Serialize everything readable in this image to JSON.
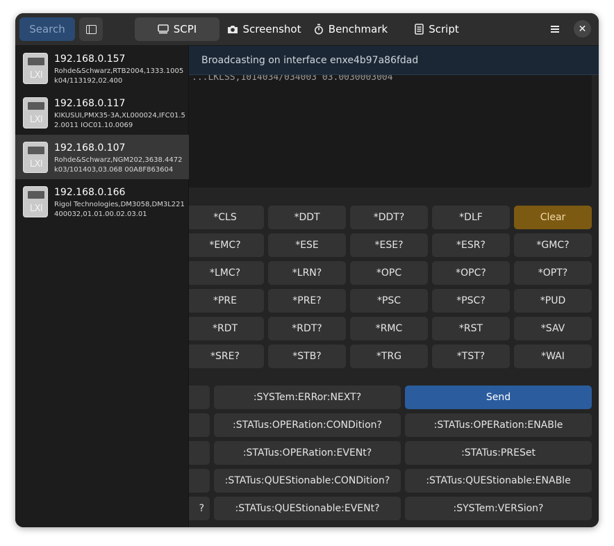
{
  "header": {
    "search_label": "Search",
    "tabs": [
      {
        "label": "SCPI",
        "icon": "monitor-icon",
        "active": true
      },
      {
        "label": "Screenshot",
        "icon": "camera-icon",
        "active": false
      },
      {
        "label": "Benchmark",
        "icon": "stopwatch-icon",
        "active": false
      },
      {
        "label": "Script",
        "icon": "document-icon",
        "active": false
      }
    ]
  },
  "banner": "Broadcasting on interface enxe4b97a86fdad",
  "response_text": "...LKLSS,1014034/034003 03.0030003004",
  "devices": [
    {
      "ip": "192.168.0.157",
      "id": "Rohde&Schwarz,RTB2004,1333.1005k04/113192,02.400",
      "selected": false
    },
    {
      "ip": "192.168.0.117",
      "id": "KIKUSUI,PMX35-3A,XL000024,IFC01.52.0011 IOC01.10.0069",
      "selected": false
    },
    {
      "ip": "192.168.0.107",
      "id": "Rohde&Schwarz,NGM202,3638.4472k03/101403,03.068 00A8F863604",
      "selected": true
    },
    {
      "ip": "192.168.0.166",
      "id": "Rigol Technologies,DM3058,DM3L221400032,01.01.00.02.03.01",
      "selected": false
    }
  ],
  "lxi_label": "LXI",
  "common_commands": [
    [
      "*CLS",
      "*DDT",
      "*DDT?",
      "*DLF",
      "Clear"
    ],
    [
      "*EMC?",
      "*ESE",
      "*ESE?",
      "*ESR?",
      "*GMC?"
    ],
    [
      "*LMC?",
      "*LRN?",
      "*OPC",
      "*OPC?",
      "*OPT?"
    ],
    [
      "*PRE",
      "*PRE?",
      "*PSC",
      "*PSC?",
      "*PUD"
    ],
    [
      "*RDT",
      "*RDT?",
      "*RMC",
      "*RST",
      "*SAV"
    ],
    [
      "*SRE?",
      "*STB?",
      "*TRG",
      "*TST?",
      "*WAI"
    ]
  ],
  "scpi_commands": [
    [
      "",
      ":SYSTem:ERRor:NEXT?",
      "Send"
    ],
    [
      "",
      ":STATus:OPERation:CONDition?",
      ":STATus:OPERation:ENABle"
    ],
    [
      "",
      ":STATus:OPERation:EVENt?",
      ":STATus:PRESet"
    ],
    [
      "",
      ":STATus:QUEStionable:CONDition?",
      ":STATus:QUEStionable:ENABle"
    ],
    [
      "?",
      ":STATus:QUEStionable:EVENt?",
      ":SYSTem:VERSion?"
    ]
  ],
  "colors": {
    "accent": "#2b5c9e",
    "clear": "#7d5a12",
    "search": "#2a4a73"
  }
}
